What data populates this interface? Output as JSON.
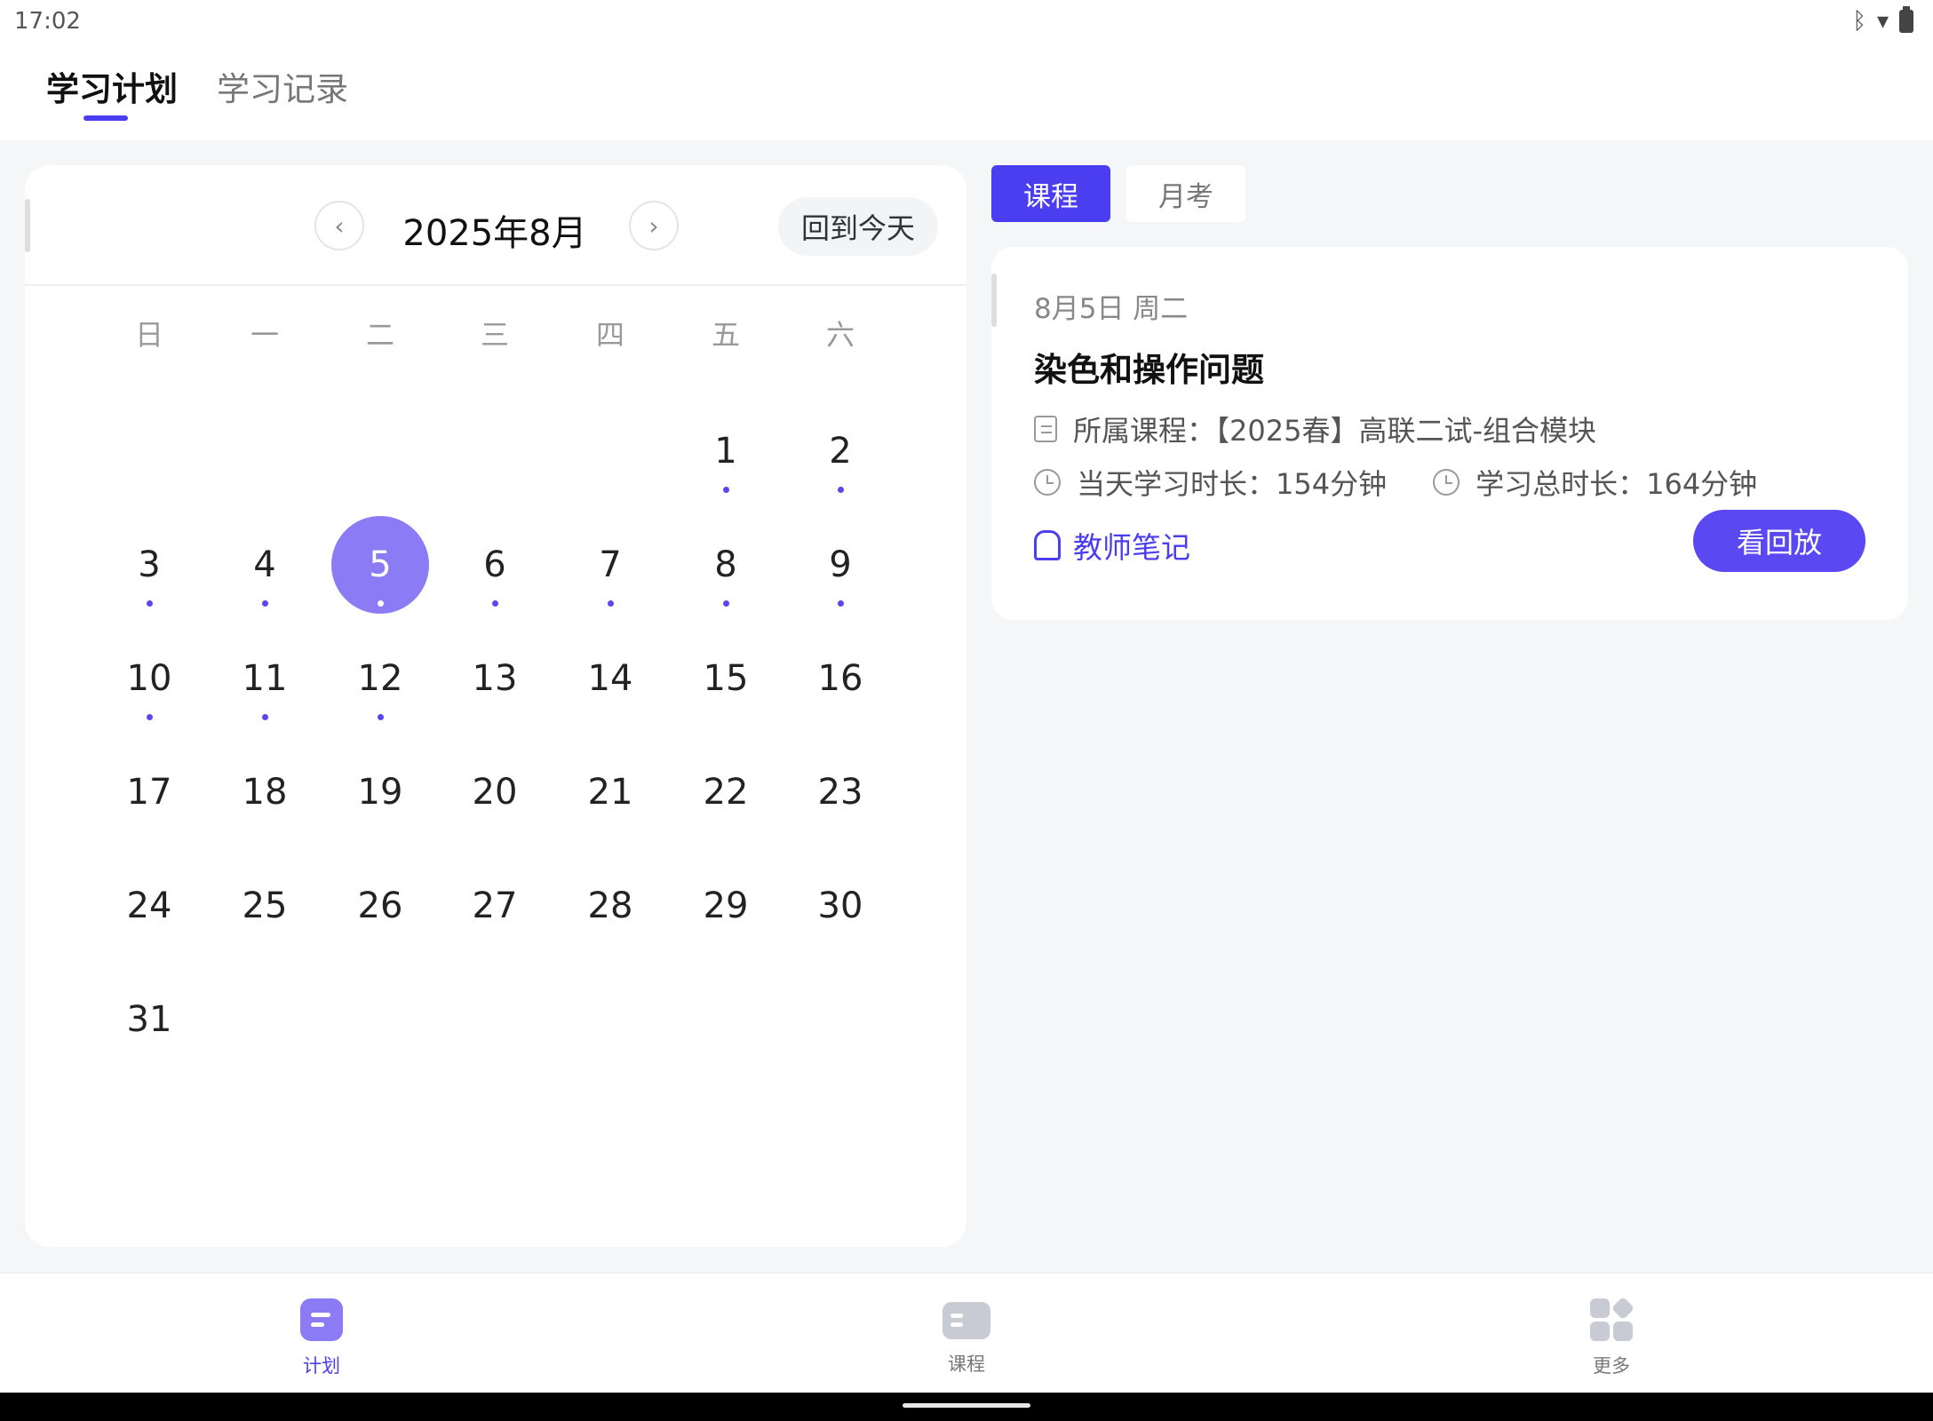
{
  "status": {
    "time": "17:02"
  },
  "tabs": [
    "学习计划",
    "学习记录"
  ],
  "calendar": {
    "month_title": "2025年8月",
    "today_label": "回到今天",
    "weekdays": [
      "日",
      "一",
      "二",
      "三",
      "四",
      "五",
      "六"
    ],
    "first_weekday": 5,
    "days": 31,
    "selected_day": 5,
    "dot_days": [
      1,
      2,
      3,
      4,
      5,
      6,
      7,
      8,
      9,
      10,
      11,
      12
    ]
  },
  "sub_tabs": [
    "课程",
    "月考"
  ],
  "lesson": {
    "date": "8月5日 周二",
    "title": "染色和操作问题",
    "course_label": "所属课程：【2025春】高联二试-组合模块",
    "day_duration": "当天学习时长：154分钟",
    "total_duration": "学习总时长：164分钟",
    "notes_label": "教师笔记",
    "replay_label": "看回放"
  },
  "bottom_nav": [
    {
      "label": "计划",
      "icon": "plan-icon"
    },
    {
      "label": "课程",
      "icon": "course-icon"
    },
    {
      "label": "更多",
      "icon": "more-icon"
    }
  ],
  "colors": {
    "accent": "#4b3df0",
    "selected_day": "#8b7cf6"
  }
}
